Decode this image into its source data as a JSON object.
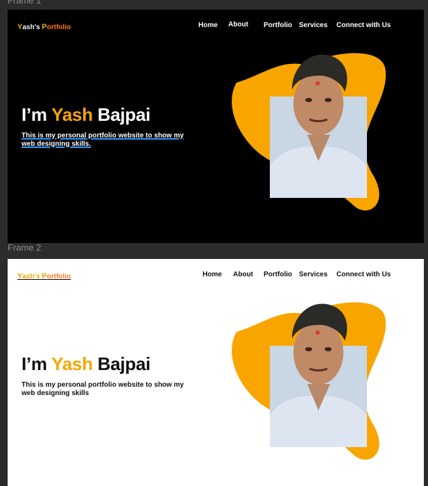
{
  "frames": [
    {
      "label": "Frame 1",
      "logo": {
        "y": "Y",
        "w1": "ash's",
        "p": "P",
        "w2": "ortfolio"
      },
      "nav": {
        "home": "Home",
        "about": "About",
        "portfolio": "Portfolio",
        "services": "Services",
        "connect": "Connect with Us"
      },
      "hero": {
        "im": "I’m",
        "first": "Yash",
        "last": "Bajpai",
        "subtitle": "This is my personal portfolio website to show my web designing skills."
      }
    },
    {
      "label": "Frame 2",
      "logo": {
        "y": "Y",
        "w1": "ash's",
        "p": "P",
        "w2": "ortfolio"
      },
      "nav": {
        "home": "Home",
        "about": "About",
        "portfolio": "Portfolio",
        "services": "Services",
        "connect": "Connect with Us"
      },
      "hero": {
        "im": "I’m",
        "first": "Yash",
        "last": "Bajpai",
        "subtitle": "This is my personal portfolio website to show my web designing skills"
      }
    }
  ],
  "colors": {
    "accent": "#f8a500",
    "logo_orange": "#ff7a1a",
    "underline_blue": "#2f9bff"
  },
  "icons": {
    "portrait": "profile-photo-icon"
  }
}
